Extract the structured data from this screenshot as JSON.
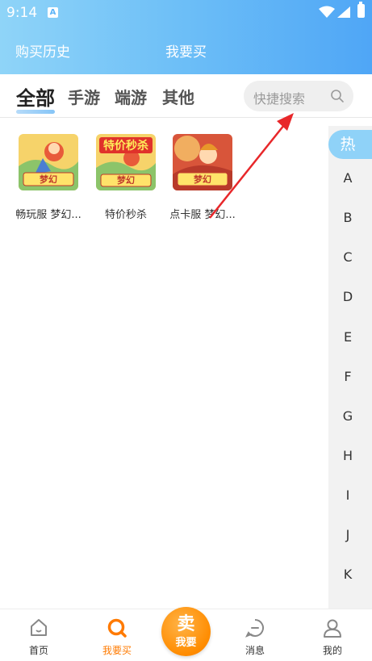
{
  "status_bar": {
    "time": "9:14",
    "notification_icon": "A"
  },
  "header": {
    "history_label": "购买历史",
    "title": "我要买"
  },
  "tabs": [
    {
      "label": "全部",
      "active": true
    },
    {
      "label": "手游",
      "active": false
    },
    {
      "label": "端游",
      "active": false
    },
    {
      "label": "其他",
      "active": false
    }
  ],
  "search": {
    "placeholder": "快捷搜索"
  },
  "games": [
    {
      "title": "畅玩服 梦幻...",
      "thumb_text": ""
    },
    {
      "title": "特价秒杀",
      "thumb_text": "特价秒杀"
    },
    {
      "title": "点卡服 梦幻...",
      "thumb_text": ""
    }
  ],
  "index_bar": {
    "hot": "热",
    "letters": [
      "A",
      "B",
      "C",
      "D",
      "E",
      "F",
      "G",
      "H",
      "I",
      "J",
      "K"
    ]
  },
  "bottom_nav": {
    "home": "首页",
    "buy": "我要买",
    "sell_main": "卖",
    "sell_sub": "我要",
    "messages": "消息",
    "mine": "我的"
  },
  "colors": {
    "accent": "#ff7a00",
    "header_start": "#8fd4f8",
    "header_end": "#4fa6f6",
    "annotation": "#e8272a"
  }
}
